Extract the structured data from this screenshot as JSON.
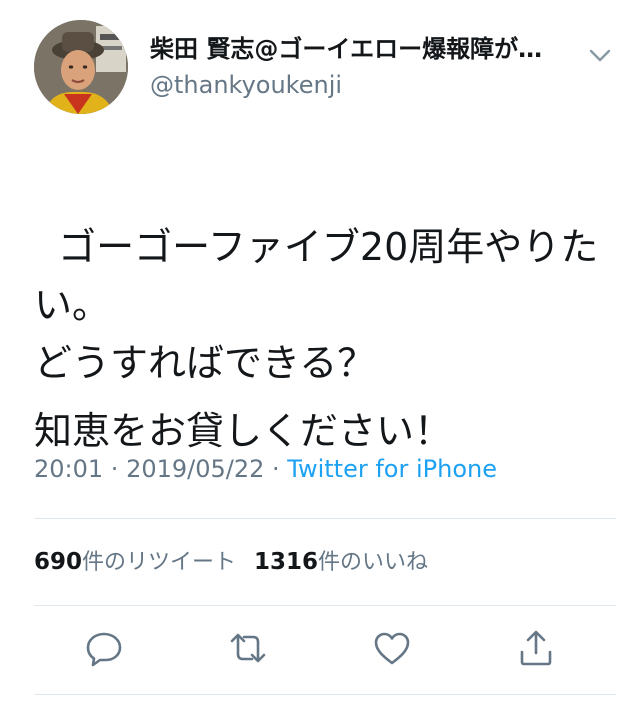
{
  "user": {
    "display_name": "柴田 賢志@ゴーイエロー爆報障が…",
    "handle": "@thankyoukenji"
  },
  "tweet": {
    "line1": "ゴーゴーファイブ20周年やりたい。\nどうすればできる？",
    "line2": "知恵をお貸しください！"
  },
  "meta": {
    "time": "20:01",
    "separator1": " · ",
    "date": "2019/05/22",
    "separator2": " · ",
    "source": "Twitter for iPhone"
  },
  "stats": {
    "retweets_count": "690",
    "retweets_label": "件のリツイート",
    "likes_count": "1316",
    "likes_label": "件のいいね"
  },
  "icons": {
    "more": "chevron-down-icon",
    "reply": "reply-icon",
    "retweet": "retweet-icon",
    "like": "heart-icon",
    "share": "share-icon"
  },
  "colors": {
    "text": "#14171a",
    "secondary": "#657786",
    "link": "#1da1f2",
    "divider": "#e1e8ed"
  }
}
